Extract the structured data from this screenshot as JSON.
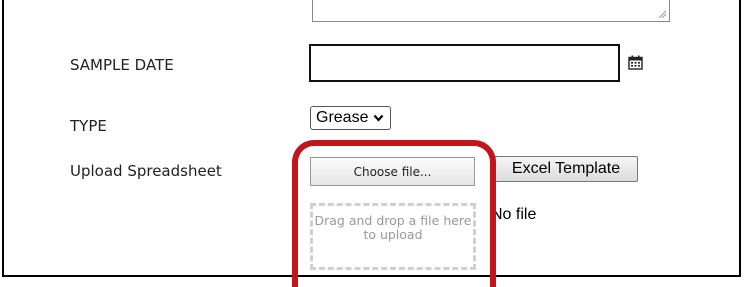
{
  "form": {
    "sample_date": {
      "label": "SAMPLE DATE",
      "value": "",
      "icon": "calendar-icon"
    },
    "type": {
      "label": "TYPE",
      "selected": "Grease",
      "icon": "chevron-down-icon"
    },
    "upload": {
      "label": "Upload Spreadsheet",
      "choose_label": "Choose file...",
      "template_label": "Excel Template",
      "dropzone_text": "Drag and drop a file here to upload",
      "status": "No file"
    }
  },
  "colors": {
    "highlight": "#c0161c",
    "dropzone_border": "#d0d0d0",
    "dropzone_text": "#9a9a9a"
  }
}
